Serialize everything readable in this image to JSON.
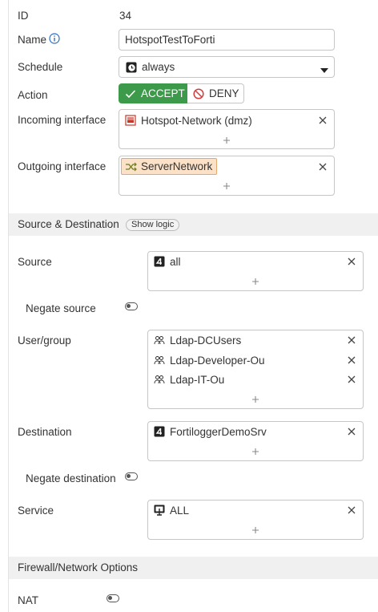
{
  "policy": {
    "id_label": "ID",
    "id_value": "34",
    "name_label": "Name",
    "name_value": "HotspotTestToForti",
    "schedule_label": "Schedule",
    "schedule_value": "always",
    "action_label": "Action",
    "accept_label": "ACCEPT",
    "deny_label": "DENY",
    "incoming_label": "Incoming interface",
    "incoming_value": "Hotspot-Network (dmz)",
    "outgoing_label": "Outgoing interface",
    "outgoing_value": "ServerNetwork"
  },
  "source_destination": {
    "section_title": "Source & Destination",
    "show_logic_label": "Show logic",
    "source_label": "Source",
    "source_items": [
      "all"
    ],
    "negate_source_label": "Negate source",
    "user_group_label": "User/group",
    "user_group_items": [
      "Ldap-DCUsers",
      "Ldap-Developer-Ou",
      "Ldap-IT-Ou"
    ],
    "destination_label": "Destination",
    "destination_items": [
      "FortiloggerDemoSrv"
    ],
    "negate_destination_label": "Negate destination",
    "service_label": "Service",
    "service_items": [
      "ALL"
    ]
  },
  "firewall_options": {
    "section_title": "Firewall/Network Options",
    "nat_label": "NAT"
  },
  "colors": {
    "accept_green": "#3d9a4a",
    "section_bg": "#f0f0f0",
    "tag_bg": "#fbe1c7",
    "info_blue": "#2a6fc9"
  },
  "icons": {
    "name_info": "info-icon",
    "schedule": "clock-icon",
    "incoming": "interface-port-icon",
    "outgoing": "shuffle-icon",
    "address": "address-icon",
    "user_group": "users-icon",
    "service": "service-icon"
  }
}
